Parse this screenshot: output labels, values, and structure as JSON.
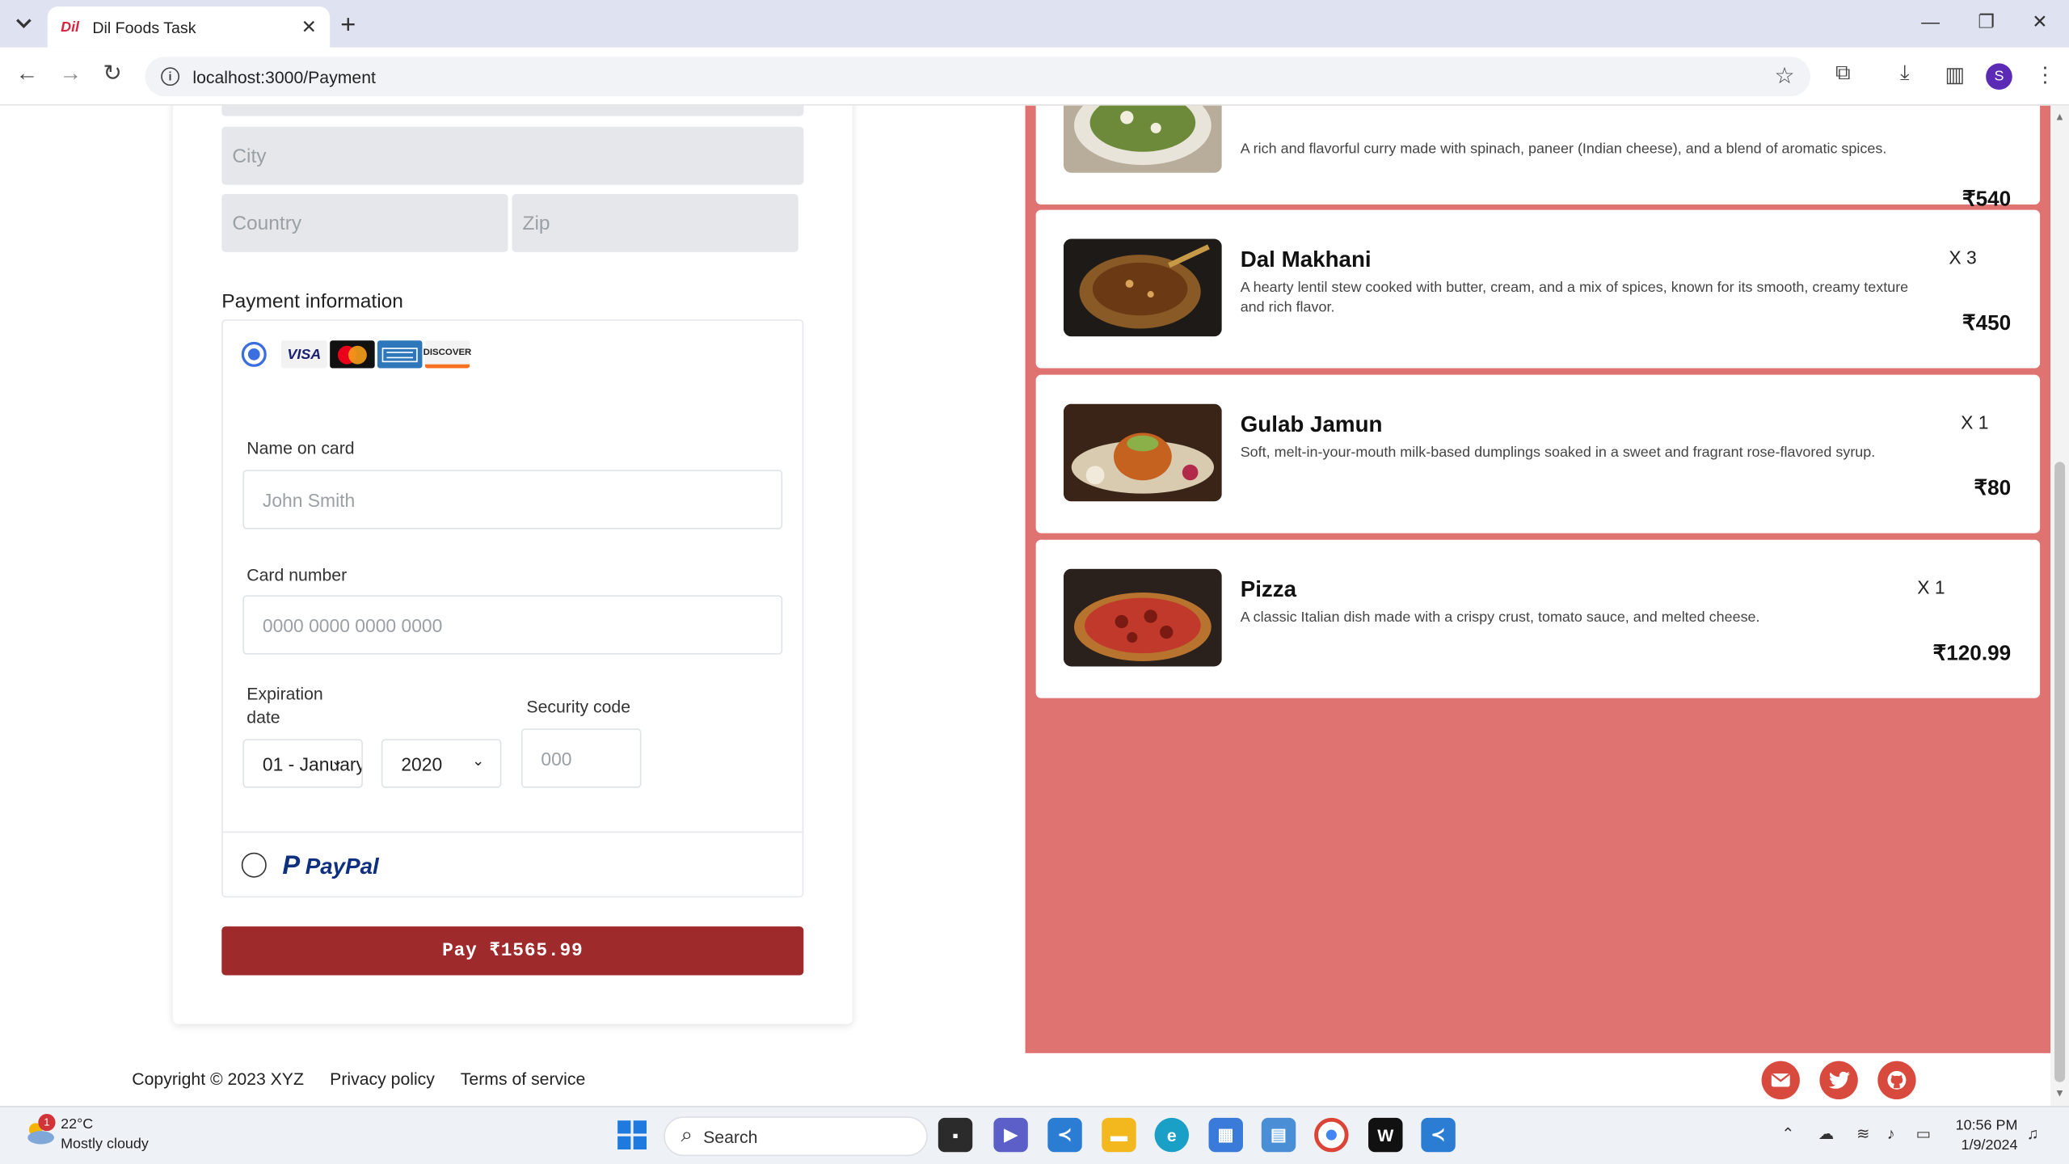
{
  "browser": {
    "tab_title": "Dil Foods Task",
    "favicon_text": "Dil",
    "url": "localhost:3000/Payment",
    "profile_initial": "S"
  },
  "address_form": {
    "city_placeholder": "City",
    "country_placeholder": "Country",
    "zip_placeholder": "Zip"
  },
  "payment": {
    "section_title": "Payment information",
    "card_brands": [
      "VISA",
      "Mastercard",
      "American Express",
      "DISCOVER"
    ],
    "name_label": "Name on card",
    "name_placeholder": "John Smith",
    "card_label": "Card number",
    "card_placeholder": "0000 0000 0000 0000",
    "exp_label": "Expiration date",
    "exp_month": "01 - January",
    "exp_year": "2020",
    "sec_label": "Security code",
    "sec_placeholder": "000",
    "paypal_text": "PayPal",
    "pay_button": "Pay ₹1565.99"
  },
  "order_items": [
    {
      "name": "",
      "desc": "A rich and flavorful curry made with spinach, paneer (Indian cheese), and a blend of aromatic spices.",
      "qty": "",
      "price": "₹540"
    },
    {
      "name": "Dal Makhani",
      "desc": "A hearty lentil stew cooked with butter, cream, and a mix of spices, known for its smooth, creamy texture and rich flavor.",
      "qty": "X 3",
      "price": "₹450"
    },
    {
      "name": "Gulab Jamun",
      "desc": "Soft, melt-in-your-mouth milk-based dumplings soaked in a sweet and fragrant rose-flavored syrup.",
      "qty": "X 1",
      "price": "₹80"
    },
    {
      "name": "Pizza",
      "desc": "A classic Italian dish made with a crispy crust, tomato sauce, and melted cheese.",
      "qty": "X 1",
      "price": "₹120.99"
    }
  ],
  "footer": {
    "copyright": "Copyright © 2023 XYZ",
    "privacy": "Privacy policy",
    "terms": "Terms of service",
    "social_icons": [
      "mail-icon",
      "twitter-icon",
      "github-icon"
    ]
  },
  "taskbar": {
    "weather_temp": "22°C",
    "weather_desc": "Mostly cloudy",
    "weather_badge": "1",
    "search_label": "Search",
    "time": "10:56 PM",
    "date": "1/9/2024"
  },
  "colors": {
    "order_panel_bg": "#df7371",
    "pay_button_bg": "#9e2a2b",
    "radio_selected": "#3b6fe0",
    "social_bg": "#d84a3e"
  }
}
